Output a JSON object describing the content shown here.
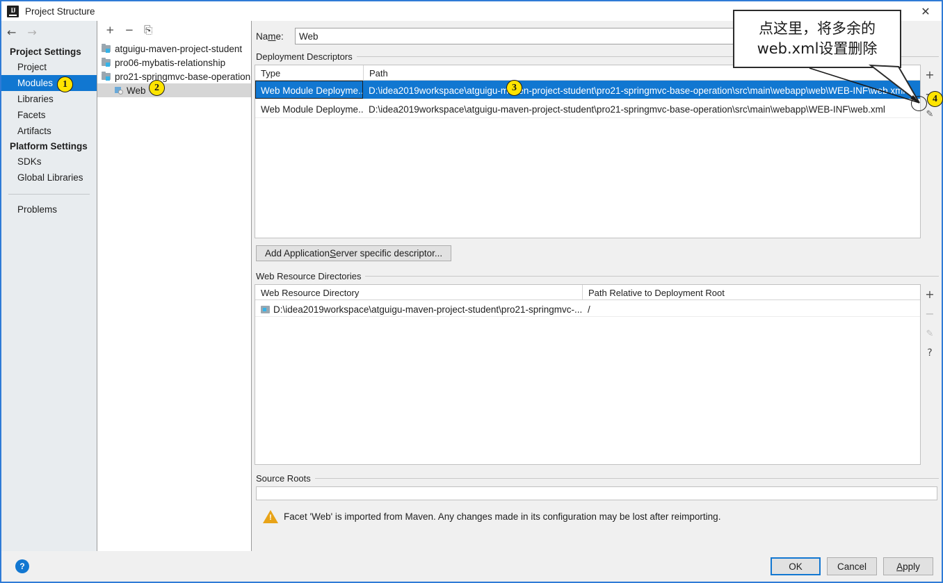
{
  "window": {
    "title": "Project Structure",
    "app_icon": "intellij-idea-icon",
    "close_label": "✕"
  },
  "sidebar": {
    "back_icon": "←",
    "forward_icon": "→",
    "groups": [
      {
        "title": "Project Settings",
        "items": [
          {
            "label": "Project",
            "selected": false
          },
          {
            "label": "Modules",
            "selected": true
          },
          {
            "label": "Libraries",
            "selected": false
          },
          {
            "label": "Facets",
            "selected": false
          },
          {
            "label": "Artifacts",
            "selected": false
          }
        ]
      },
      {
        "title": "Platform Settings",
        "items": [
          {
            "label": "SDKs",
            "selected": false
          },
          {
            "label": "Global Libraries",
            "selected": false
          }
        ]
      }
    ],
    "problems": "Problems"
  },
  "tree": {
    "toolbar": {
      "add": "+",
      "remove": "−",
      "copy": "⎘"
    },
    "nodes": [
      {
        "label": "atguigu-maven-project-student",
        "kind": "module",
        "selected": false
      },
      {
        "label": "pro06-mybatis-relationship",
        "kind": "module",
        "selected": false
      },
      {
        "label": "pro21-springmvc-base-operation",
        "kind": "module",
        "selected": false
      },
      {
        "label": "Web",
        "kind": "facet",
        "selected": true
      }
    ]
  },
  "main": {
    "name_label_pre": "Na",
    "name_label_accel": "m",
    "name_label_post": "e:",
    "name_value": "Web",
    "deployment_descriptors": {
      "group_title": "Deployment Descriptors",
      "columns": [
        "Type",
        "Path"
      ],
      "rows": [
        {
          "type": "Web Module Deployme...",
          "path": "D:\\idea2019workspace\\atguigu-maven-project-student\\pro21-springmvc-base-operation\\src\\main\\webapp\\web\\WEB-INF\\web.xml",
          "selected": true
        },
        {
          "type": "Web Module Deployme...",
          "path": "D:\\idea2019workspace\\atguigu-maven-project-student\\pro21-springmvc-base-operation\\src\\main\\webapp\\WEB-INF\\web.xml",
          "selected": false
        }
      ],
      "toolbar": {
        "add": "+",
        "remove": "−",
        "edit": "✎"
      }
    },
    "add_descriptor_button": {
      "pre": "Add Application ",
      "accel": "S",
      "post": "erver specific descriptor..."
    },
    "web_resource_directories": {
      "group_title": "Web Resource Directories",
      "columns": [
        "Web Resource Directory",
        "Path Relative to Deployment Root"
      ],
      "rows": [
        {
          "directory": "D:\\idea2019workspace\\atguigu-maven-project-student\\pro21-springmvc-...",
          "relative_path": "/"
        }
      ],
      "toolbar": {
        "add": "+",
        "remove": "−",
        "edit": "✎",
        "help": "?"
      }
    },
    "source_roots": {
      "group_title": "Source Roots",
      "value": ""
    },
    "warning": "Facet 'Web' is imported from Maven. Any changes made in its configuration may be lost after reimporting."
  },
  "footer": {
    "help": "?",
    "ok": "OK",
    "cancel": "Cancel",
    "apply_pre": "",
    "apply_accel": "A",
    "apply_post": "pply"
  },
  "annotations": {
    "callout": {
      "line1": "点这里，将多余的",
      "line2": "web.xml设置删除"
    },
    "badges": [
      "1",
      "2",
      "3",
      "4"
    ],
    "highlight_color": "#ffe400"
  }
}
